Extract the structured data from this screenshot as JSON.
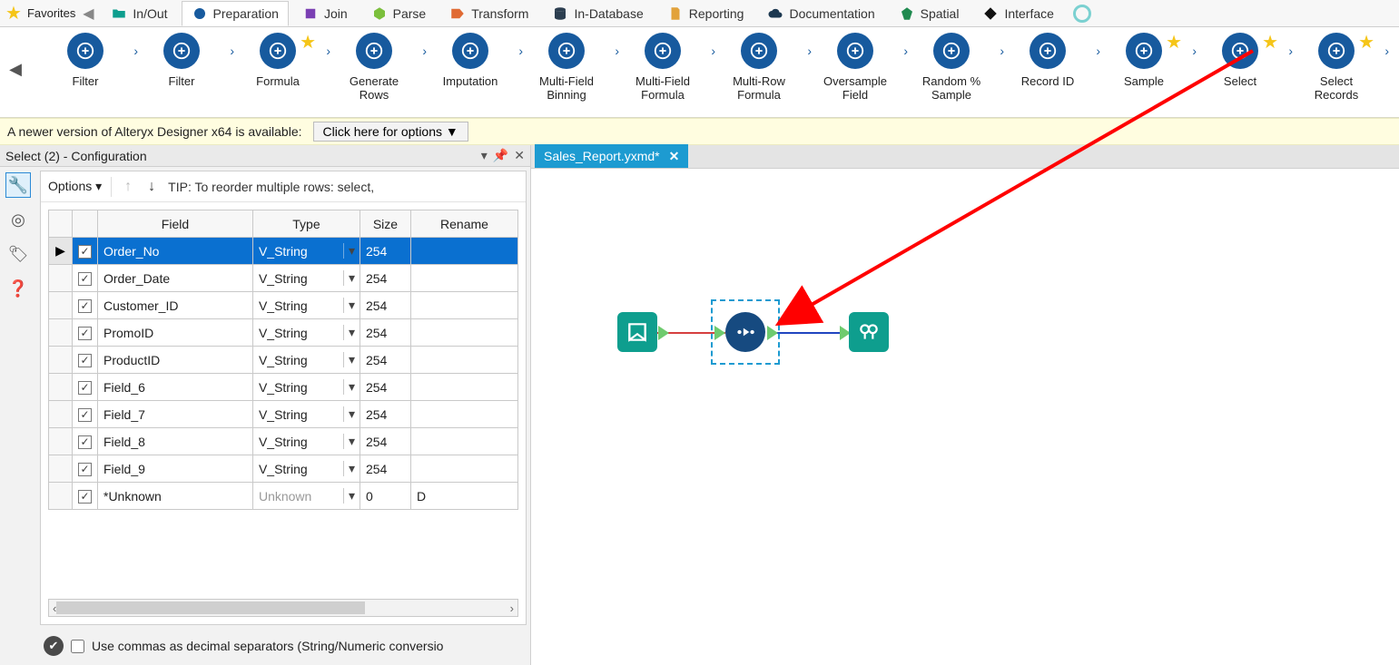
{
  "cat_strip": {
    "favorites_label": "Favorites",
    "tabs": [
      {
        "label": "In/Out",
        "color": "#0e9e8e",
        "shape": "folder"
      },
      {
        "label": "Preparation",
        "color": "#175a9e",
        "shape": "circle",
        "active": true
      },
      {
        "label": "Join",
        "color": "#7a3fb3",
        "shape": "square"
      },
      {
        "label": "Parse",
        "color": "#7bbf3c",
        "shape": "hex"
      },
      {
        "label": "Transform",
        "color": "#e06a33",
        "shape": "tag"
      },
      {
        "label": "In-Database",
        "color": "#2c3e50",
        "shape": "db"
      },
      {
        "label": "Reporting",
        "color": "#e2a23b",
        "shape": "doc"
      },
      {
        "label": "Documentation",
        "color": "#1c3850",
        "shape": "cloud"
      },
      {
        "label": "Spatial",
        "color": "#1f8a4f",
        "shape": "gem"
      },
      {
        "label": "Interface",
        "color": "#111111",
        "shape": "diamond"
      }
    ]
  },
  "palette": [
    {
      "label": "Filter",
      "fav": false
    },
    {
      "label": "Filter",
      "fav": false
    },
    {
      "label": "Formula",
      "fav": true
    },
    {
      "label": "Generate Rows",
      "fav": false
    },
    {
      "label": "Imputation",
      "fav": false
    },
    {
      "label": "Multi-Field Binning",
      "fav": false
    },
    {
      "label": "Multi-Field Formula",
      "fav": false
    },
    {
      "label": "Multi-Row Formula",
      "fav": false
    },
    {
      "label": "Oversample Field",
      "fav": false
    },
    {
      "label": "Random % Sample",
      "fav": false
    },
    {
      "label": "Record ID",
      "fav": false
    },
    {
      "label": "Sample",
      "fav": true
    },
    {
      "label": "Select",
      "fav": true
    },
    {
      "label": "Select Records",
      "fav": true
    }
  ],
  "update_bar": {
    "text": "A newer version of Alteryx Designer x64 is available:",
    "button": "Click here for options ▼"
  },
  "left_pane": {
    "title": "Select (2) - Configuration",
    "options_label": "Options ▾",
    "tip": "TIP: To reorder multiple rows: select,",
    "columns": {
      "field": "Field",
      "type": "Type",
      "size": "Size",
      "rename": "Rename"
    },
    "rows": [
      {
        "field": "Order_No",
        "type": "V_String",
        "size": "254",
        "rename": "",
        "checked": true,
        "selected": true
      },
      {
        "field": "Order_Date",
        "type": "V_String",
        "size": "254",
        "rename": "",
        "checked": true
      },
      {
        "field": "Customer_ID",
        "type": "V_String",
        "size": "254",
        "rename": "",
        "checked": true
      },
      {
        "field": "PromoID",
        "type": "V_String",
        "size": "254",
        "rename": "",
        "checked": true
      },
      {
        "field": "ProductID",
        "type": "V_String",
        "size": "254",
        "rename": "",
        "checked": true
      },
      {
        "field": "Field_6",
        "type": "V_String",
        "size": "254",
        "rename": "",
        "checked": true
      },
      {
        "field": "Field_7",
        "type": "V_String",
        "size": "254",
        "rename": "",
        "checked": true
      },
      {
        "field": "Field_8",
        "type": "V_String",
        "size": "254",
        "rename": "",
        "checked": true
      },
      {
        "field": "Field_9",
        "type": "V_String",
        "size": "254",
        "rename": "",
        "checked": true
      },
      {
        "field": "*Unknown",
        "type": "Unknown",
        "size": "0",
        "rename": "D",
        "checked": true,
        "unknown": true
      }
    ],
    "footer_label": "Use commas as decimal separators (String/Numeric conversio"
  },
  "document": {
    "name": "Sales_Report.yxmd*"
  }
}
